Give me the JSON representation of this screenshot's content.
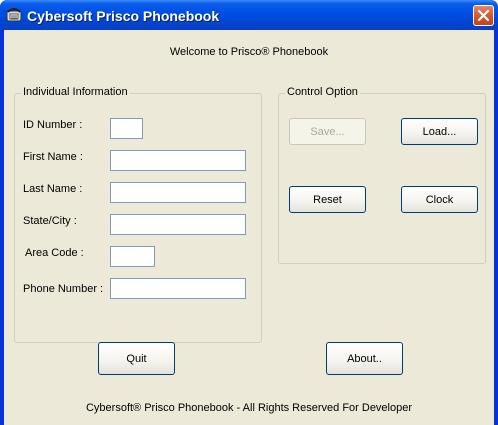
{
  "window": {
    "title": "Cybersoft Prisco Phonebook"
  },
  "welcome_text": "Welcome to Prisco® Phonebook",
  "individual_info": {
    "title": "Individual Information",
    "fields": {
      "id_number": {
        "label": "ID Number :",
        "value": ""
      },
      "first_name": {
        "label": "First Name :",
        "value": ""
      },
      "last_name": {
        "label": "Last Name :",
        "value": ""
      },
      "state_city": {
        "label": "State/City :",
        "value": ""
      },
      "area_code": {
        "label": "Area Code :",
        "value": ""
      },
      "phone_number": {
        "label": "Phone Number :",
        "value": ""
      }
    }
  },
  "control_option": {
    "title": "Control Option",
    "save_label": "Save...",
    "load_label": "Load...",
    "reset_label": "Reset",
    "clock_label": "Clock"
  },
  "buttons": {
    "quit_label": "Quit",
    "about_label": "About.."
  },
  "footer_text": "Cybersoft® Prisco Phonebook  - All Rights Reserved For Developer",
  "colors": {
    "titlebar": "#0054e3",
    "client_bg": "#ece9d8",
    "close_button": "#d95a32"
  },
  "icons": {
    "app": "phone-icon",
    "close": "close-icon"
  }
}
